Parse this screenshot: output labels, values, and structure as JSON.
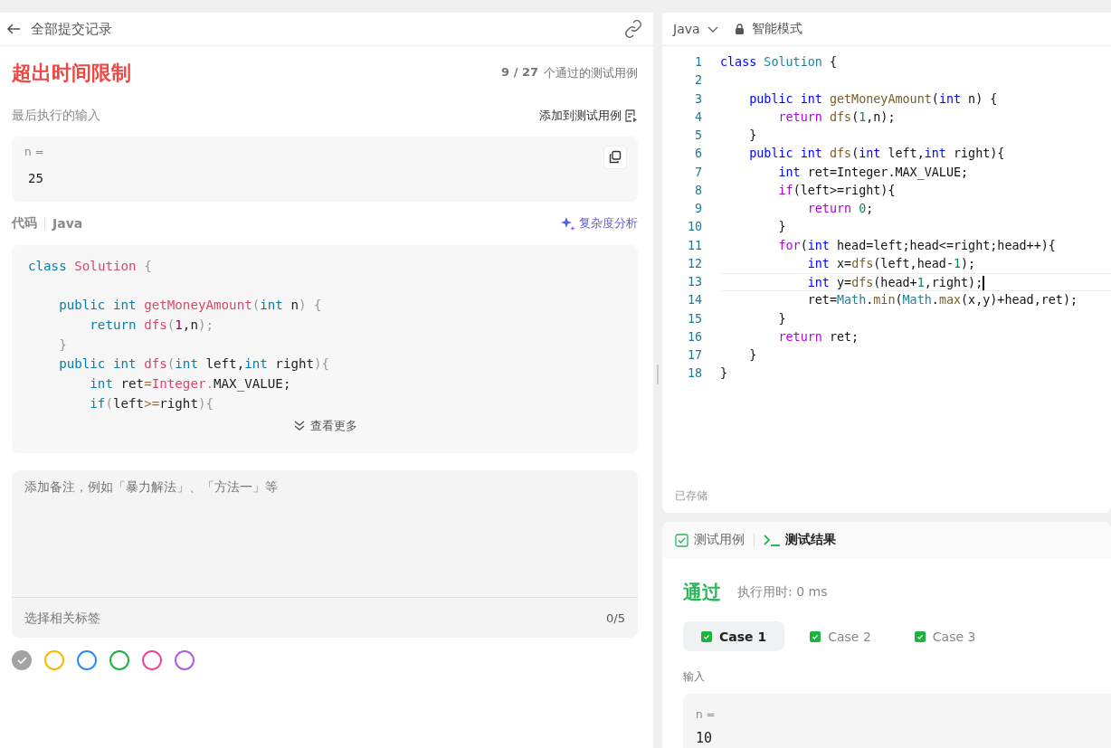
{
  "left_panel": {
    "back_label": "全部提交记录",
    "status": "超出时间限制",
    "passed": "9 / 27",
    "passed_suffix": "个通过的测试用例",
    "last_input_label": "最后执行的输入",
    "add_to_tests": "添加到测试用例",
    "last_input": {
      "name": "n =",
      "value": "25"
    },
    "code_label": "代码",
    "language": "Java",
    "analysis_link": "复杂度分析",
    "code_lines": [
      {
        "tokens": [
          {
            "kind": "kw",
            "text": "class"
          },
          {
            "kind": "type",
            "text": " Solution"
          },
          {
            "kind": "punc",
            "text": " {"
          }
        ]
      },
      {
        "space_before": true,
        "tokens": [
          {
            "kind": "kw",
            "text": "    public"
          },
          {
            "kind": "kw",
            "text": " int"
          },
          {
            "kind": "fn",
            "text": " getMoneyAmount"
          },
          {
            "kind": "punc",
            "text": "("
          },
          {
            "kind": "kw",
            "text": "int"
          },
          {
            "kind": "plain",
            "text": " n"
          },
          {
            "kind": "punc",
            "text": ") {"
          }
        ]
      },
      {
        "tokens": [
          {
            "kind": "kw",
            "text": "        return"
          },
          {
            "kind": "fn",
            "text": " dfs"
          },
          {
            "kind": "punc",
            "text": "("
          },
          {
            "kind": "num",
            "text": "1"
          },
          {
            "kind": "plain",
            "text": ",n"
          },
          {
            "kind": "punc",
            "text": ");"
          }
        ]
      },
      {
        "tokens": [
          {
            "kind": "punc",
            "text": "    }"
          }
        ]
      },
      {
        "tokens": [
          {
            "kind": "kw",
            "text": "    public"
          },
          {
            "kind": "kw",
            "text": " int"
          },
          {
            "kind": "fn",
            "text": " dfs"
          },
          {
            "kind": "punc",
            "text": "("
          },
          {
            "kind": "kw",
            "text": "int"
          },
          {
            "kind": "plain",
            "text": " left,"
          },
          {
            "kind": "kw",
            "text": "int"
          },
          {
            "kind": "plain",
            "text": " right"
          },
          {
            "kind": "punc",
            "text": "){"
          }
        ]
      },
      {
        "tokens": [
          {
            "kind": "kw",
            "text": "        int"
          },
          {
            "kind": "plain",
            "text": " ret"
          },
          {
            "kind": "op",
            "text": "="
          },
          {
            "kind": "type",
            "text": "Integer"
          },
          {
            "kind": "punc",
            "text": "."
          },
          {
            "kind": "plain",
            "text": "MAX_VALUE;"
          }
        ]
      },
      {
        "tokens": [
          {
            "kind": "kw",
            "text": "        if"
          },
          {
            "kind": "punc",
            "text": "("
          },
          {
            "kind": "plain",
            "text": "left"
          },
          {
            "kind": "op",
            "text": ">="
          },
          {
            "kind": "plain",
            "text": "right"
          },
          {
            "kind": "punc",
            "text": "){"
          }
        ]
      }
    ],
    "show_more": "查看更多",
    "note": {
      "placeholder": "添加备注，例如「暴力解法」、「方法一」等",
      "tags_placeholder": "选择相关标签",
      "tag_count": "0/5"
    },
    "colors": [
      {
        "color": "#a3a3a3",
        "selected": true
      },
      {
        "color": "#ffb800",
        "selected": false
      },
      {
        "color": "#2d8cf0",
        "selected": false
      },
      {
        "color": "#1cb33d",
        "selected": false
      },
      {
        "color": "#ec4899",
        "selected": false
      },
      {
        "color": "#b05ce8",
        "selected": false
      }
    ]
  },
  "editor": {
    "language": "Java",
    "mode": "智能模式",
    "saved": "已存储",
    "lines": [
      {
        "number": "1",
        "current": false,
        "tokens": [
          {
            "kind": "decl",
            "text": "class"
          },
          {
            "kind": "type",
            "text": " Solution"
          },
          {
            "kind": "plain",
            "text": " {"
          }
        ]
      },
      {
        "number": "2",
        "current": false
      },
      {
        "number": "3",
        "current": false,
        "tokens": [
          {
            "kind": "kw",
            "text": "    public"
          },
          {
            "kind": "kw",
            "text": " int"
          },
          {
            "kind": "fn",
            "text": " getMoneyAmount"
          },
          {
            "kind": "plain",
            "text": "("
          },
          {
            "kind": "kw",
            "text": "int"
          },
          {
            "kind": "plain",
            "text": " n) {"
          }
        ]
      },
      {
        "number": "4",
        "current": false,
        "tokens": [
          {
            "kind": "ctrl",
            "text": "        return"
          },
          {
            "kind": "fn",
            "text": " dfs"
          },
          {
            "kind": "plain",
            "text": "("
          },
          {
            "kind": "num",
            "text": "1"
          },
          {
            "kind": "plain",
            "text": ",n);"
          }
        ]
      },
      {
        "number": "5",
        "current": false,
        "tokens": [
          {
            "kind": "plain",
            "text": "    }"
          }
        ]
      },
      {
        "number": "6",
        "current": false,
        "tokens": [
          {
            "kind": "kw",
            "text": "    public"
          },
          {
            "kind": "kw",
            "text": " int"
          },
          {
            "kind": "fn",
            "text": " dfs"
          },
          {
            "kind": "plain",
            "text": "("
          },
          {
            "kind": "kw",
            "text": "int"
          },
          {
            "kind": "plain",
            "text": " left,"
          },
          {
            "kind": "kw",
            "text": "int"
          },
          {
            "kind": "plain",
            "text": " right){"
          }
        ]
      },
      {
        "number": "7",
        "current": false,
        "tokens": [
          {
            "kind": "kw",
            "text": "        int"
          },
          {
            "kind": "plain",
            "text": " ret=Integer.MAX_VALUE;"
          }
        ]
      },
      {
        "number": "8",
        "current": false,
        "tokens": [
          {
            "kind": "ctrl",
            "text": "        if"
          },
          {
            "kind": "plain",
            "text": "(left>=right){"
          }
        ]
      },
      {
        "number": "9",
        "current": false,
        "tokens": [
          {
            "kind": "ctrl",
            "text": "            return"
          },
          {
            "kind": "num",
            "text": " 0"
          },
          {
            "kind": "plain",
            "text": ";"
          }
        ]
      },
      {
        "number": "10",
        "current": false,
        "tokens": [
          {
            "kind": "plain",
            "text": "        }"
          }
        ]
      },
      {
        "number": "11",
        "current": false,
        "tokens": [
          {
            "kind": "ctrl",
            "text": "        for"
          },
          {
            "kind": "plain",
            "text": "("
          },
          {
            "kind": "kw",
            "text": "int"
          },
          {
            "kind": "plain",
            "text": " head=left;head<=right;head++){"
          }
        ]
      },
      {
        "number": "12",
        "current": false,
        "tokens": [
          {
            "kind": "kw",
            "text": "            int"
          },
          {
            "kind": "plain",
            "text": " x="
          },
          {
            "kind": "fn",
            "text": "dfs"
          },
          {
            "kind": "plain",
            "text": "(left,head-"
          },
          {
            "kind": "num",
            "text": "1"
          },
          {
            "kind": "plain",
            "text": ");"
          }
        ]
      },
      {
        "number": "13",
        "current": true,
        "tokens": [
          {
            "kind": "kw",
            "text": "            int"
          },
          {
            "kind": "plain",
            "text": " y="
          },
          {
            "kind": "fn",
            "text": "dfs"
          },
          {
            "kind": "plain",
            "text": "(head+"
          },
          {
            "kind": "num",
            "text": "1"
          },
          {
            "kind": "plain",
            "text": ",right);"
          }
        ]
      },
      {
        "number": "14",
        "current": false,
        "tokens": [
          {
            "kind": "plain",
            "text": "            ret="
          },
          {
            "kind": "type",
            "text": "Math"
          },
          {
            "kind": "plain",
            "text": "."
          },
          {
            "kind": "fn",
            "text": "min"
          },
          {
            "kind": "plain",
            "text": "("
          },
          {
            "kind": "type",
            "text": "Math"
          },
          {
            "kind": "plain",
            "text": "."
          },
          {
            "kind": "fn",
            "text": "max"
          },
          {
            "kind": "plain",
            "text": "(x,y)+head,ret);"
          }
        ]
      },
      {
        "number": "15",
        "current": false,
        "tokens": [
          {
            "kind": "plain",
            "text": "        }"
          }
        ]
      },
      {
        "number": "16",
        "current": false,
        "tokens": [
          {
            "kind": "ctrl",
            "text": "        return"
          },
          {
            "kind": "plain",
            "text": " ret;"
          }
        ]
      },
      {
        "number": "17",
        "current": false,
        "tokens": [
          {
            "kind": "plain",
            "text": "    }"
          }
        ]
      },
      {
        "number": "18",
        "current": false,
        "tokens": [
          {
            "kind": "plain",
            "text": "}"
          }
        ]
      }
    ]
  },
  "test_panel": {
    "tabs": [
      {
        "label": "测试用例",
        "kind": "cases",
        "selected": false
      },
      {
        "label": "测试结果",
        "kind": "result",
        "selected": true
      }
    ],
    "verdict": "通过",
    "runtime": "执行用时: 0 ms",
    "cases": [
      {
        "label": "Case 1",
        "selected": true
      },
      {
        "label": "Case 2",
        "selected": false
      },
      {
        "label": "Case 3",
        "selected": false
      }
    ],
    "input_label": "输入",
    "input": {
      "name": "n =",
      "value": "10"
    }
  }
}
